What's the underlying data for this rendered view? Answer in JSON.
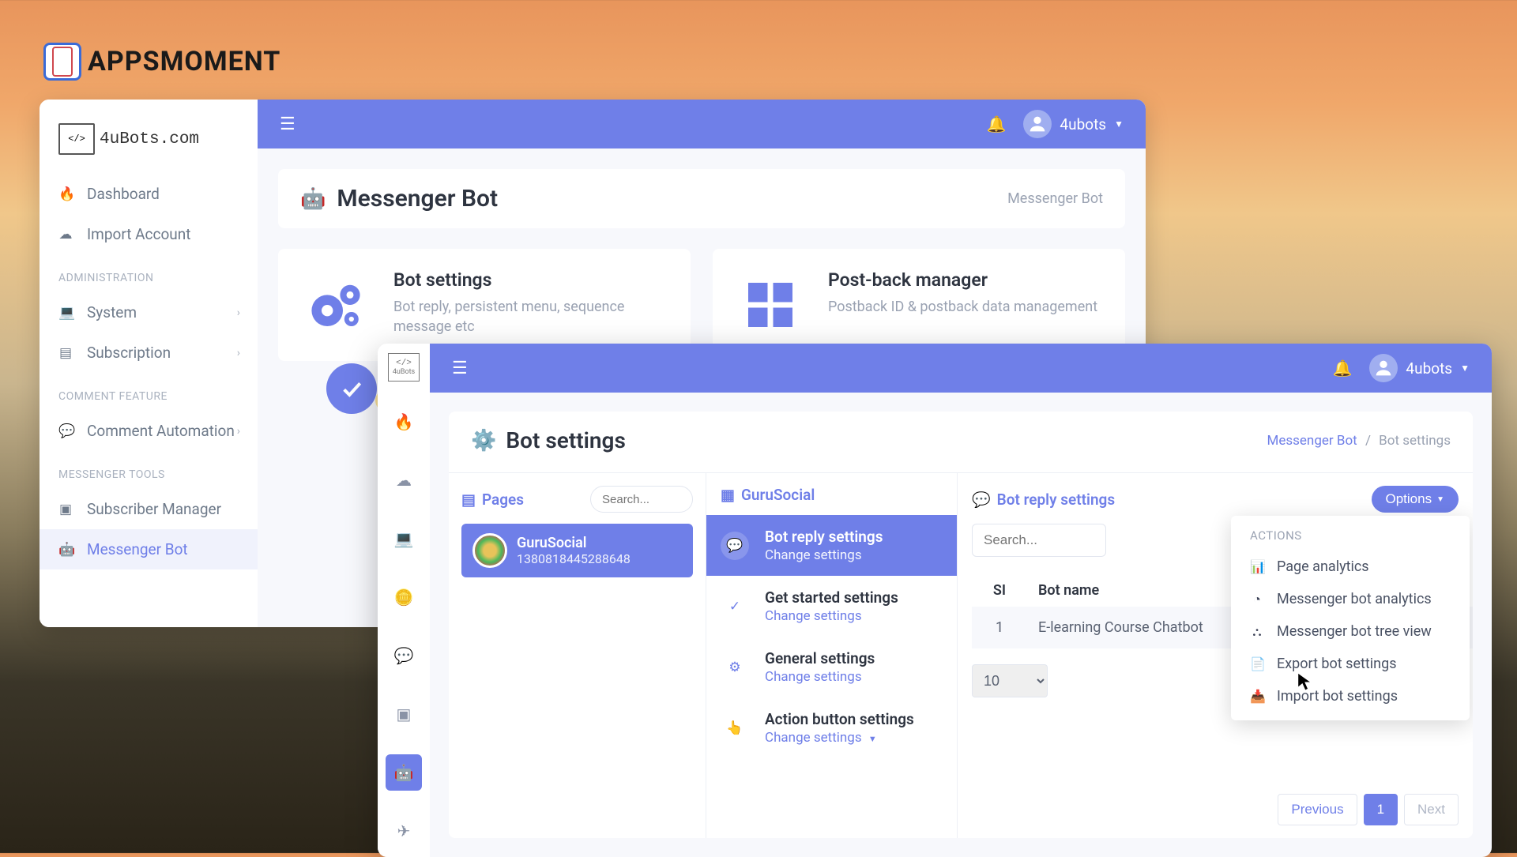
{
  "brand": {
    "name": "APPSMOMENT"
  },
  "win1": {
    "logo_text": "4uBots.com",
    "logo_glyph": "</>",
    "user": "4ubots",
    "sections": {
      "admin": "ADMINISTRATION",
      "comment": "COMMENT FEATURE",
      "messenger": "MESSENGER TOOLS"
    },
    "nav": {
      "dashboard": "Dashboard",
      "import": "Import Account",
      "system": "System",
      "subscription": "Subscription",
      "comment_automation": "Comment Automation",
      "subscriber_manager": "Subscriber Manager",
      "messenger_bot": "Messenger Bot"
    },
    "header": {
      "title": "Messenger Bot",
      "bc": "Messenger Bot"
    },
    "cards": {
      "bot_settings": {
        "title": "Bot settings",
        "desc": "Bot reply, persistent menu, sequence message etc"
      },
      "postback": {
        "title": "Post-back manager",
        "desc": "Postback ID & postback data management"
      }
    }
  },
  "win2": {
    "user": "4ubots",
    "rail_logo": {
      "glyph": "</>",
      "name": "4uBots"
    },
    "header": {
      "title": "Bot settings"
    },
    "breadcrumb": {
      "a": "Messenger Bot",
      "sep": "/",
      "b": "Bot settings"
    },
    "pages_panel": {
      "title": "Pages",
      "search_placeholder": "Search..."
    },
    "page": {
      "name": "GuruSocial",
      "id": "1380818445288648"
    },
    "guru_panel": {
      "title": "GuruSocial"
    },
    "settings_items": [
      {
        "title": "Bot reply settings",
        "link": "Change settings"
      },
      {
        "title": "Get started settings",
        "link": "Change settings"
      },
      {
        "title": "General settings",
        "link": "Change settings"
      },
      {
        "title": "Action button settings",
        "link": "Change settings"
      }
    ],
    "reply_panel": {
      "title": "Bot reply settings",
      "options": "Options",
      "search_placeholder": "Search...",
      "col_si": "SI",
      "col_name": "Bot name",
      "row_si": "1",
      "row_name": "E-learning Course Chatbot",
      "page_size": "10"
    },
    "pagination": {
      "prev": "Previous",
      "page": "1",
      "next": "Next"
    },
    "actions": {
      "title": "ACTIONS",
      "items": [
        "Page analytics",
        "Messenger bot analytics",
        "Messenger bot tree view",
        "Export bot settings",
        "Import bot settings"
      ]
    }
  }
}
